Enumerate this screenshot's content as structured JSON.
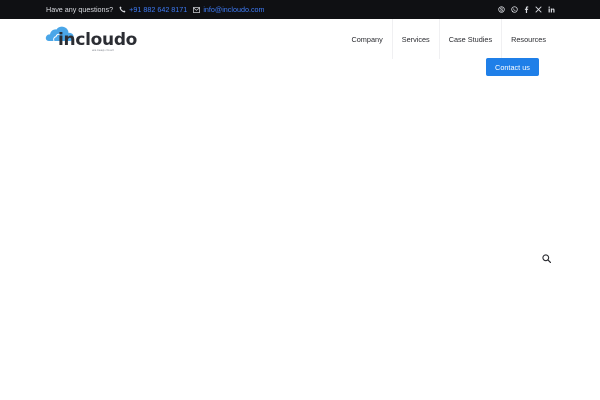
{
  "topbar": {
    "question": "Have any questions?",
    "phone": "+91 882 642 8171",
    "email": "info@incloudo.com",
    "social": [
      "skype-icon",
      "whatsapp-icon",
      "facebook-icon",
      "x-icon",
      "linkedin-icon"
    ]
  },
  "header": {
    "logo_text": "incloudo",
    "logo_tagline": "we keep cloud"
  },
  "nav": {
    "items": [
      {
        "label": "Company"
      },
      {
        "label": "Services"
      },
      {
        "label": "Case Studies"
      },
      {
        "label": "Resources"
      }
    ],
    "cta_label": "Contact us"
  },
  "colors": {
    "topbar_bg": "#0f1013",
    "link": "#3e7bf5",
    "cta_bg": "#1f7fe8",
    "logo_cloud": "#4aa6e8"
  },
  "icons": {
    "search": "search-icon",
    "phone": "phone-icon",
    "email": "mail-icon"
  }
}
